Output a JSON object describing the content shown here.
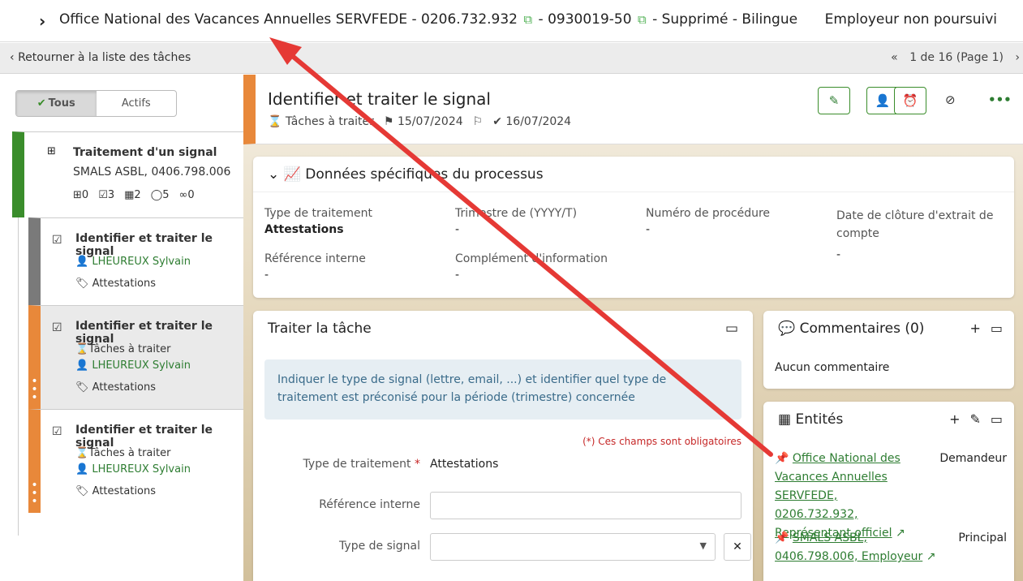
{
  "header": {
    "title_prefix": "Office National des Vacances Annuelles SERVFEDE - 0206.732.932",
    "title_mid": "- 0930019-50",
    "title_suffix": "- Supprimé - Bilingue",
    "right": "Employeur non poursuivi"
  },
  "nav": {
    "back": "Retourner à la liste des tâches",
    "pager": "1 de 16 (Page 1)"
  },
  "sidebar": {
    "toggle_all": "Tous",
    "toggle_active": "Actifs",
    "process": {
      "title": "Traitement d'un signal",
      "subtitle": "SMALS ASBL, 0406.798.006",
      "stats": [
        "0",
        "3",
        "2",
        "5",
        "0"
      ]
    },
    "tasks": [
      {
        "title": "Identifier et traiter le signal",
        "user": "LHEUREUX Sylvain",
        "tag": "Attestations"
      },
      {
        "title": "Identifier et traiter le signal",
        "status": "Tâches à traiter",
        "user": "LHEUREUX Sylvain",
        "tag": "Attestations"
      },
      {
        "title": "Identifier et traiter le signal",
        "status": "Tâches à traiter",
        "user": "LHEUREUX Sylvain",
        "tag": "Attestations"
      }
    ]
  },
  "task": {
    "title": "Identifier et traiter le signal",
    "status": "Tâches à traiter",
    "date_flag": "15/07/2024",
    "date_done": "16/07/2024"
  },
  "process_data": {
    "title": "Données spécifiques du processus",
    "fields": [
      {
        "label": "Type de traitement",
        "value": "Attestations"
      },
      {
        "label": "Trimestre de (YYYY/T)",
        "value": "-"
      },
      {
        "label": "Numéro de procédure",
        "value": "-"
      },
      {
        "label": "Date de clôture d'extrait de compte",
        "value": "-"
      },
      {
        "label": "Référence interne",
        "value": "-"
      },
      {
        "label": "Complément d'information",
        "value": "-"
      }
    ]
  },
  "treat": {
    "title": "Traiter la tâche",
    "info": "Indiquer le type de signal (lettre, email, ...) et identifier quel type de traitement est préconisé pour la période (trimestre) concernée",
    "required_note": "(*) Ces champs sont obligatoires",
    "type_label": "Type de traitement",
    "type_value": "Attestations",
    "ref_label": "Référence interne",
    "signal_label": "Type de signal"
  },
  "comments": {
    "title": "Commentaires (0)",
    "empty": "Aucun commentaire"
  },
  "entities": {
    "title": "Entités",
    "items": [
      {
        "name": "Office National des Vacances Annuelles SERVFEDE, 0206.732.932, Représentant officiel",
        "role": "Demandeur"
      },
      {
        "name": "SMALS ASBL, 0406.798.006, Employeur",
        "role": "Principal"
      }
    ]
  },
  "colors": {
    "accent": "#3a8d2b",
    "task_orange": "#e8883a",
    "arrow": "#e53935"
  }
}
